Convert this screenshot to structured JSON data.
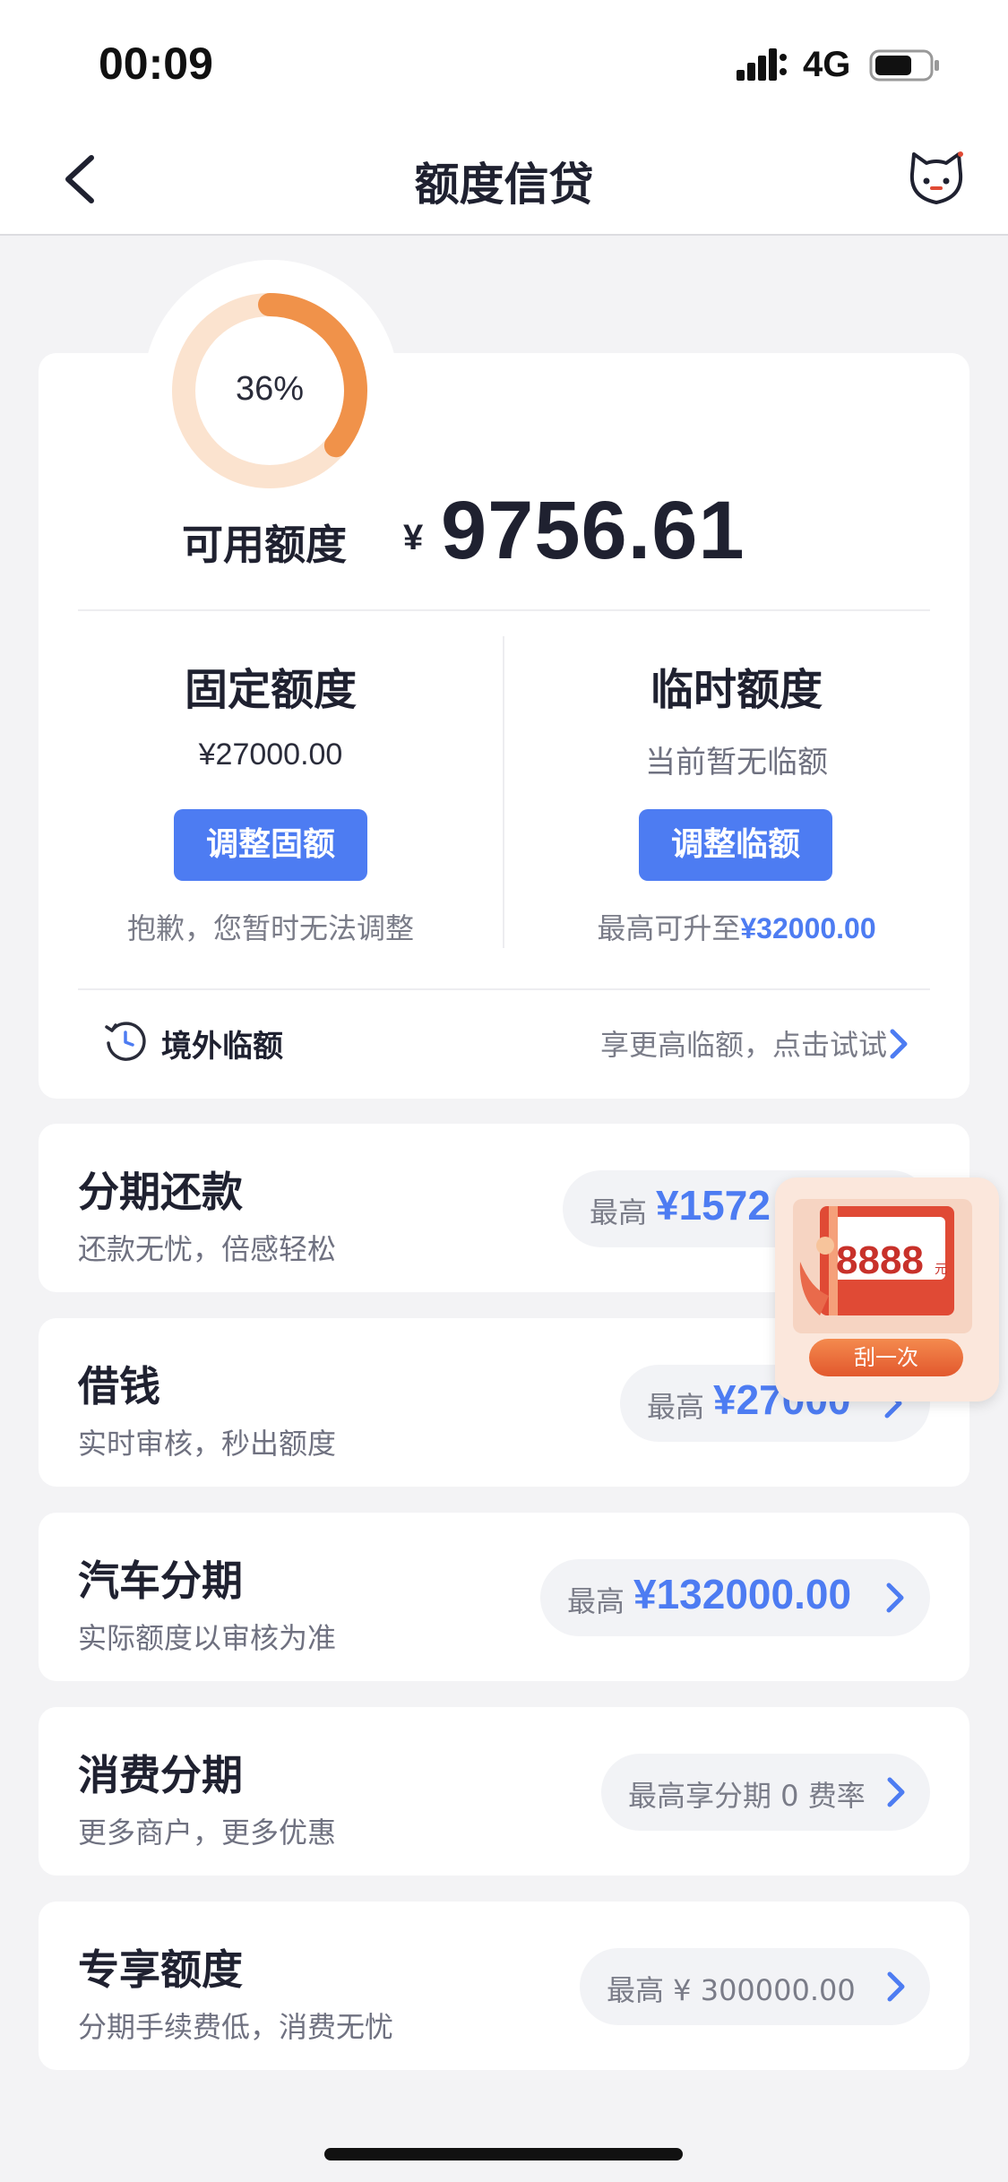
{
  "status_bar": {
    "time": "00:09",
    "network": "4G"
  },
  "header": {
    "title": "额度信贷"
  },
  "credit": {
    "usage_percent_label": "36%",
    "usage_fraction": 0.36,
    "available_label": "可用额度",
    "currency": "¥",
    "available_amount": "9756.61",
    "fixed": {
      "title": "固定额度",
      "amount": "¥27000.00",
      "button": "调整固额",
      "note": "抱歉，您暂时无法调整"
    },
    "temporary": {
      "title": "临时额度",
      "status": "当前暂无临额",
      "button": "调整临额",
      "note_prefix": "最高可升至",
      "note_amount": "¥32000.00"
    },
    "overseas": {
      "label": "境外临额",
      "hint": "享更高临额，点击试试"
    }
  },
  "products": [
    {
      "title": "分期还款",
      "subtitle": "还款无忧，倍感轻松",
      "prefix": "最高",
      "amount": "¥1572"
    },
    {
      "title": "借钱",
      "subtitle": "实时审核，秒出额度",
      "prefix": "最高",
      "amount": "¥27000"
    },
    {
      "title": "汽车分期",
      "subtitle": "实际额度以审核为准",
      "prefix": "最高",
      "amount": "¥132000.00"
    },
    {
      "title": "消费分期",
      "subtitle": "更多商户，更多优惠",
      "text": "最高享分期 0 费率"
    },
    {
      "title": "专享额度",
      "subtitle": "分期手续费低，消费无忧",
      "text": "最高 ¥ 300000.00"
    }
  ],
  "promo": {
    "amount": "8888",
    "unit": "元",
    "button": "刮一次"
  },
  "colors": {
    "accent": "#4d7cf2",
    "ring_active": "#f0924a",
    "ring_track": "#fbe3cf",
    "promo_red": "#e04a35"
  }
}
